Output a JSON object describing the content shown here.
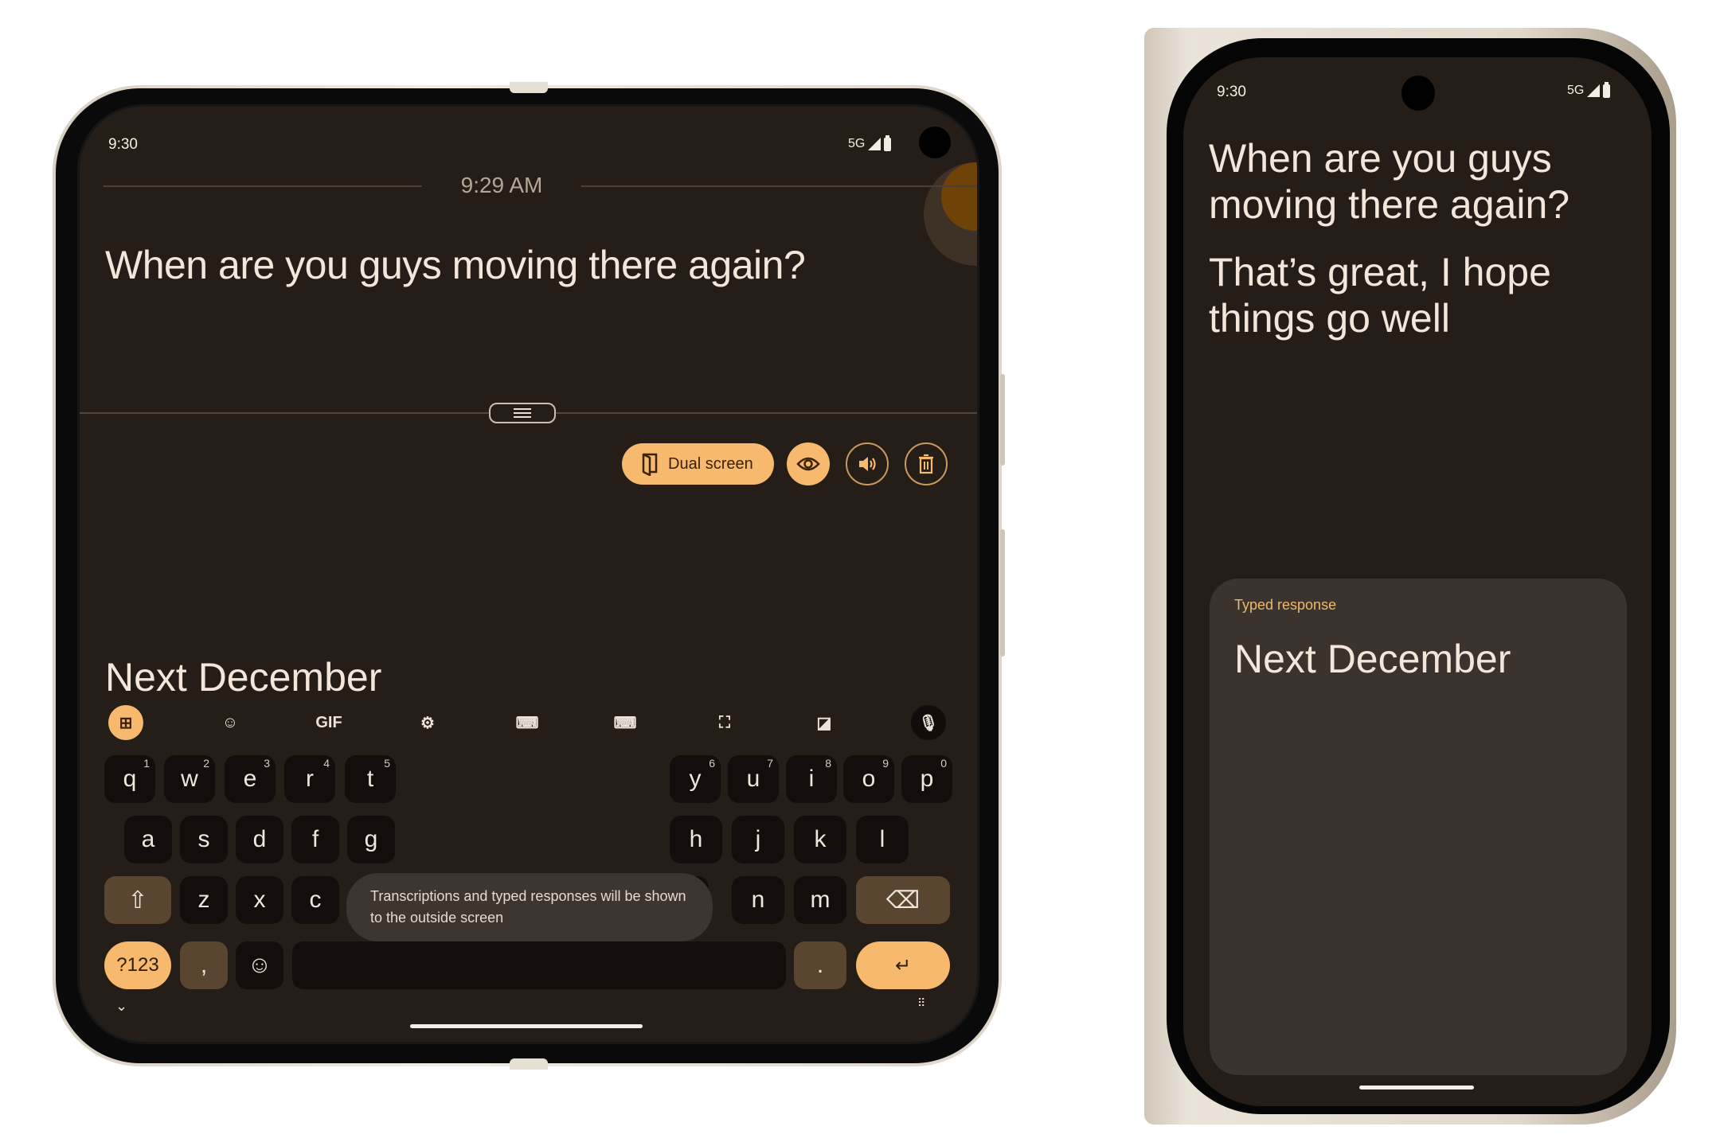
{
  "foldable": {
    "status_bar": {
      "time": "9:30",
      "network": "5G"
    },
    "timestamp": "9:29 AM",
    "transcription": "When are you guys moving there again?",
    "divider_handle": "drag-handle",
    "actions": {
      "dual_screen_label": "Dual screen",
      "view_icon": "eye-icon",
      "speak_icon": "speaker-icon",
      "delete_icon": "trash-icon"
    },
    "typed_response": "Next December",
    "keyboard": {
      "toolbar": [
        {
          "name": "apps-grid-icon",
          "glyph": "⊞"
        },
        {
          "name": "sticker-icon",
          "glyph": "☺"
        },
        {
          "name": "gif-icon",
          "glyph": "GIF"
        },
        {
          "name": "gear-icon",
          "glyph": "⚙"
        },
        {
          "name": "keyboard-icon",
          "glyph": "⌨"
        },
        {
          "name": "keyboard-dock-icon",
          "glyph": "⌨"
        },
        {
          "name": "resize-icon",
          "glyph": "⛶"
        },
        {
          "name": "floating-keyboard-icon",
          "glyph": "◪"
        },
        {
          "name": "microphone-icon",
          "glyph": "🎙"
        }
      ],
      "row1_left": [
        {
          "key": "q",
          "hint": "1"
        },
        {
          "key": "w",
          "hint": "2"
        },
        {
          "key": "e",
          "hint": "3"
        },
        {
          "key": "r",
          "hint": "4"
        },
        {
          "key": "t",
          "hint": "5"
        }
      ],
      "row1_right": [
        {
          "key": "y",
          "hint": "6"
        },
        {
          "key": "u",
          "hint": "7"
        },
        {
          "key": "i",
          "hint": "8"
        },
        {
          "key": "o",
          "hint": "9"
        },
        {
          "key": "p",
          "hint": "0"
        }
      ],
      "row2_left": [
        "a",
        "s",
        "d",
        "f",
        "g"
      ],
      "row2_right": [
        "h",
        "j",
        "k",
        "l"
      ],
      "row3_left": [
        "z",
        "x",
        "c"
      ],
      "row3_right": [
        "n",
        "m"
      ],
      "shift_glyph": "⇧",
      "backspace_glyph": "⌫",
      "symbols_label": "?123",
      "comma_label": ",",
      "emoji_glyph": "☺",
      "period_label": ".",
      "enter_glyph": "↵",
      "hide_glyph": "⌄",
      "switch_glyph": "⠿"
    },
    "tooltip": "Transcriptions and typed responses will be shown to the outside screen"
  },
  "cover_screen": {
    "status_bar": {
      "time": "9:30",
      "network": "5G"
    },
    "messages": [
      "When are you guys moving there again?",
      "That’s great, I hope things go well"
    ],
    "card": {
      "label": "Typed response",
      "text": "Next December"
    }
  },
  "colors": {
    "accent": "#f6b96e",
    "background": "#241d18",
    "card": "#3b332e",
    "modifier_key": "#5a4630"
  }
}
